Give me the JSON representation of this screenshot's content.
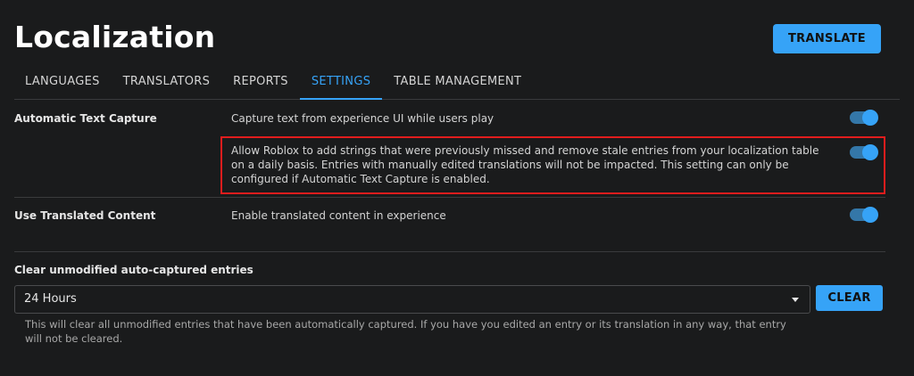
{
  "header": {
    "title": "Localization",
    "translate_label": "TRANSLATE"
  },
  "tabs": [
    {
      "label": "LANGUAGES",
      "active": false
    },
    {
      "label": "TRANSLATORS",
      "active": false
    },
    {
      "label": "REPORTS",
      "active": false
    },
    {
      "label": "SETTINGS",
      "active": true
    },
    {
      "label": "TABLE MANAGEMENT",
      "active": false
    }
  ],
  "settings": {
    "automatic_text_capture": {
      "label": "Automatic Text Capture",
      "description": "Capture text from experience UI while users play",
      "enabled": true
    },
    "auto_cleanup": {
      "description": "Allow Roblox to add strings that were previously missed and remove stale entries from your localization table on a daily basis. Entries with manually edited translations will not be impacted. This setting can only be configured if Automatic Text Capture is enabled.",
      "enabled": true
    },
    "use_translated_content": {
      "label": "Use Translated Content",
      "description": "Enable translated content in experience",
      "enabled": true
    }
  },
  "clear_section": {
    "label": "Clear unmodified auto-captured entries",
    "selected_option": "24 Hours",
    "clear_label": "CLEAR",
    "help_text": "This will clear all unmodified entries that have been automatically captured. If you have you edited an entry or its translation in any way, that entry will not be cleared."
  },
  "colors": {
    "accent": "#36a3f7",
    "highlight_border": "#e11d1d",
    "background": "#1a1b1c"
  }
}
